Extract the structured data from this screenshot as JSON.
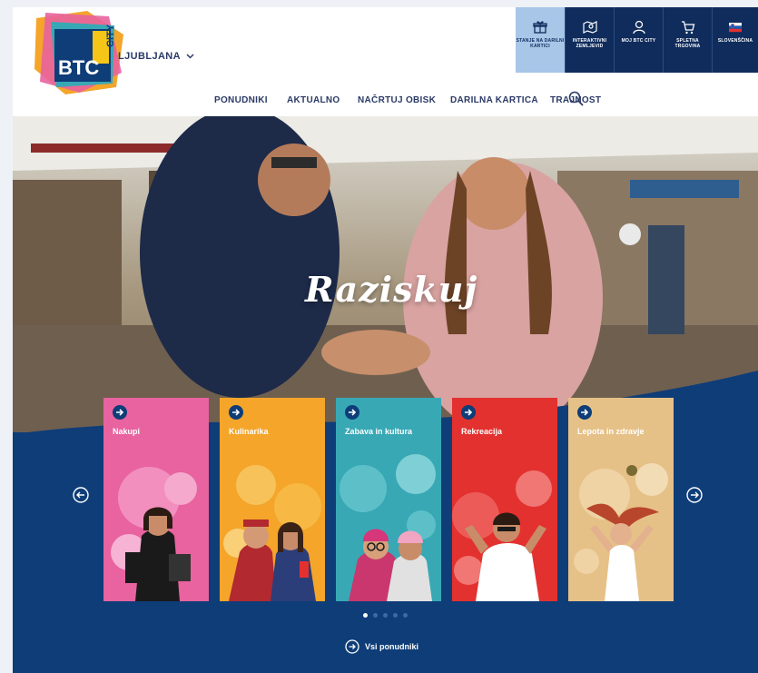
{
  "header": {
    "logo_text_main": "BTC",
    "logo_text_side": "CITY",
    "city": "LJUBLJANA",
    "utility": [
      {
        "icon": "gift-card-icon",
        "label": "STANJE NA DARILNI KARTICI"
      },
      {
        "icon": "interactive-map-icon",
        "label": "INTERAKTIVNI ZEMLJEVID"
      },
      {
        "icon": "user-icon",
        "label": "MOJ BTC CITY"
      },
      {
        "icon": "cart-icon",
        "label": "SPLETNA TRGOVINA"
      },
      {
        "icon": "slovenia-flag-icon",
        "label": "SLOVENŠČINA"
      }
    ]
  },
  "nav": {
    "items": [
      "PONUDNIKI",
      "AKTUALNO",
      "NAČRTUJ OBISK",
      "DARILNA KARTICA",
      "TRAJNOST"
    ]
  },
  "hero": {
    "title": "Raziskuj"
  },
  "cards": [
    {
      "title": "Nakupi",
      "color": "#e8639f"
    },
    {
      "title": "Kulinarika",
      "color": "#f4a52a"
    },
    {
      "title": "Zabava in kultura",
      "color": "#38a8b5"
    },
    {
      "title": "Rekreacija",
      "color": "#e3312f"
    },
    {
      "title": "Lepota in zdravje",
      "color": "#e6c187"
    }
  ],
  "carousel": {
    "dot_count": 5,
    "active_dot": 0,
    "all_label": "Vsi ponudniki"
  },
  "colors": {
    "brand_blue": "#0e3d78",
    "nav_text": "#2b3a67",
    "util_light": "#a7c6e8"
  }
}
